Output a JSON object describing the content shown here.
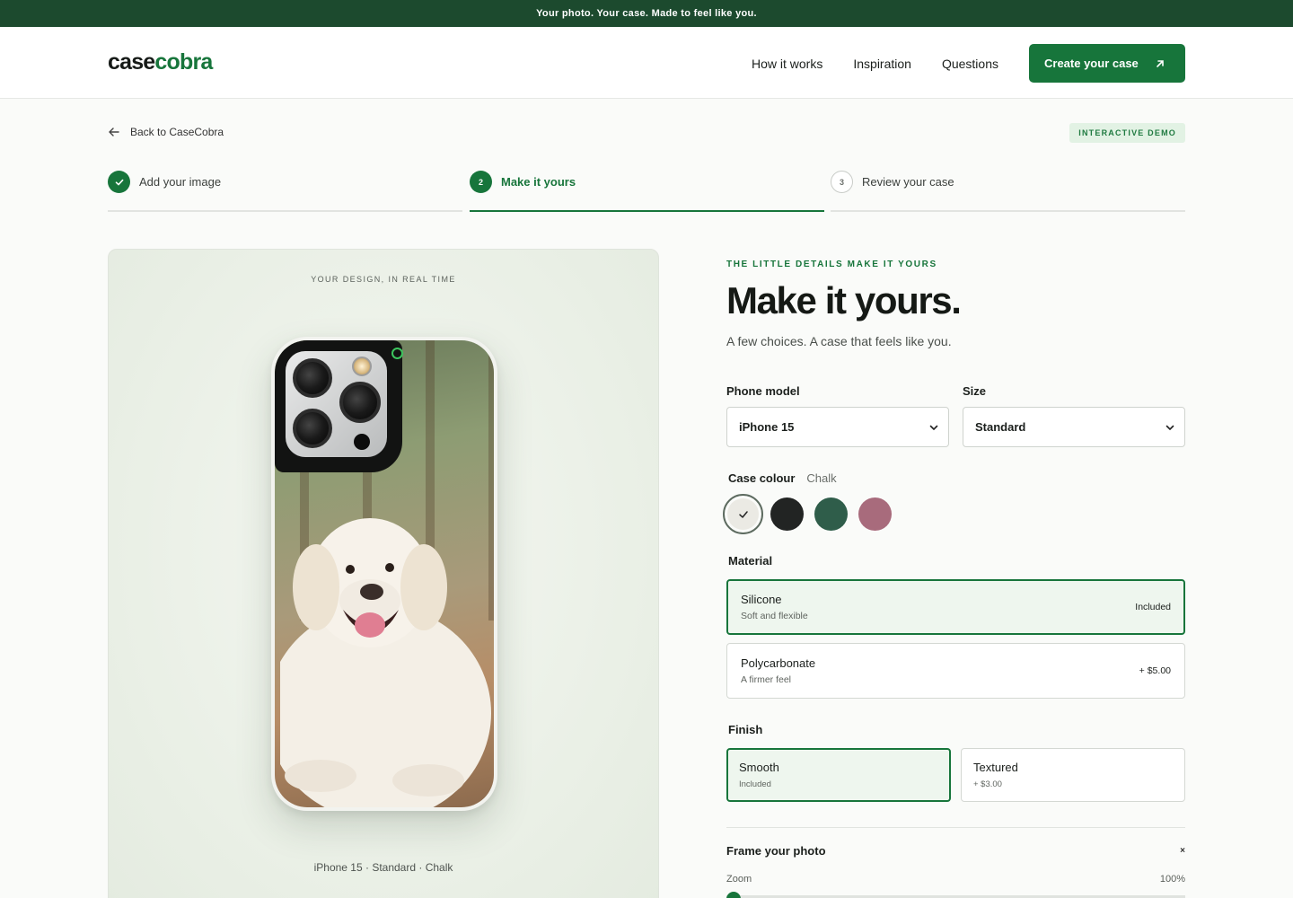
{
  "announcement": "Your photo. Your case. Made to feel like you.",
  "brand": {
    "part1": "case",
    "part2": "cobra"
  },
  "nav": {
    "links": [
      "How it works",
      "Inspiration",
      "Questions"
    ],
    "cta": "Create your case"
  },
  "back_link": "Back to CaseCobra",
  "demo_badge": "INTERACTIVE DEMO",
  "steps": [
    {
      "number": "1",
      "label": "Add your image",
      "state": "done"
    },
    {
      "number": "2",
      "label": "Make it yours",
      "state": "current"
    },
    {
      "number": "3",
      "label": "Review your case",
      "state": "todo"
    }
  ],
  "preview": {
    "caption": "YOUR DESIGN, IN REAL TIME",
    "meta": "iPhone 15 · Standard · Chalk"
  },
  "config": {
    "eyebrow": "THE LITTLE DETAILS MAKE IT YOURS",
    "title": "Make it yours.",
    "subtitle": "A few choices. A case that feels like you.",
    "phone_model": {
      "label": "Phone model",
      "value": "iPhone 15"
    },
    "size": {
      "label": "Size",
      "value": "Standard"
    },
    "colour": {
      "label": "Case colour",
      "selected": "Chalk",
      "swatches": [
        {
          "name": "Chalk",
          "hex": "#ebeae4"
        },
        {
          "name": "Black",
          "hex": "#222423"
        },
        {
          "name": "Green",
          "hex": "#2f5d4a"
        },
        {
          "name": "Rose",
          "hex": "#a86b7c"
        }
      ]
    },
    "material": {
      "label": "Material",
      "options": [
        {
          "name": "Silicone",
          "desc": "Soft and flexible",
          "price": "Included"
        },
        {
          "name": "Polycarbonate",
          "desc": "A firmer feel",
          "price": "+ $5.00"
        }
      ]
    },
    "finish": {
      "label": "Finish",
      "options": [
        {
          "name": "Smooth",
          "desc": "Included"
        },
        {
          "name": "Textured",
          "desc": "+ $3.00"
        }
      ]
    },
    "frame": {
      "title": "Frame your photo",
      "close": "×",
      "zoom_label": "Zoom",
      "zoom_value": "100%"
    }
  },
  "colors": {
    "accent": "#17753b",
    "announce_bg": "#1c4a2e"
  }
}
